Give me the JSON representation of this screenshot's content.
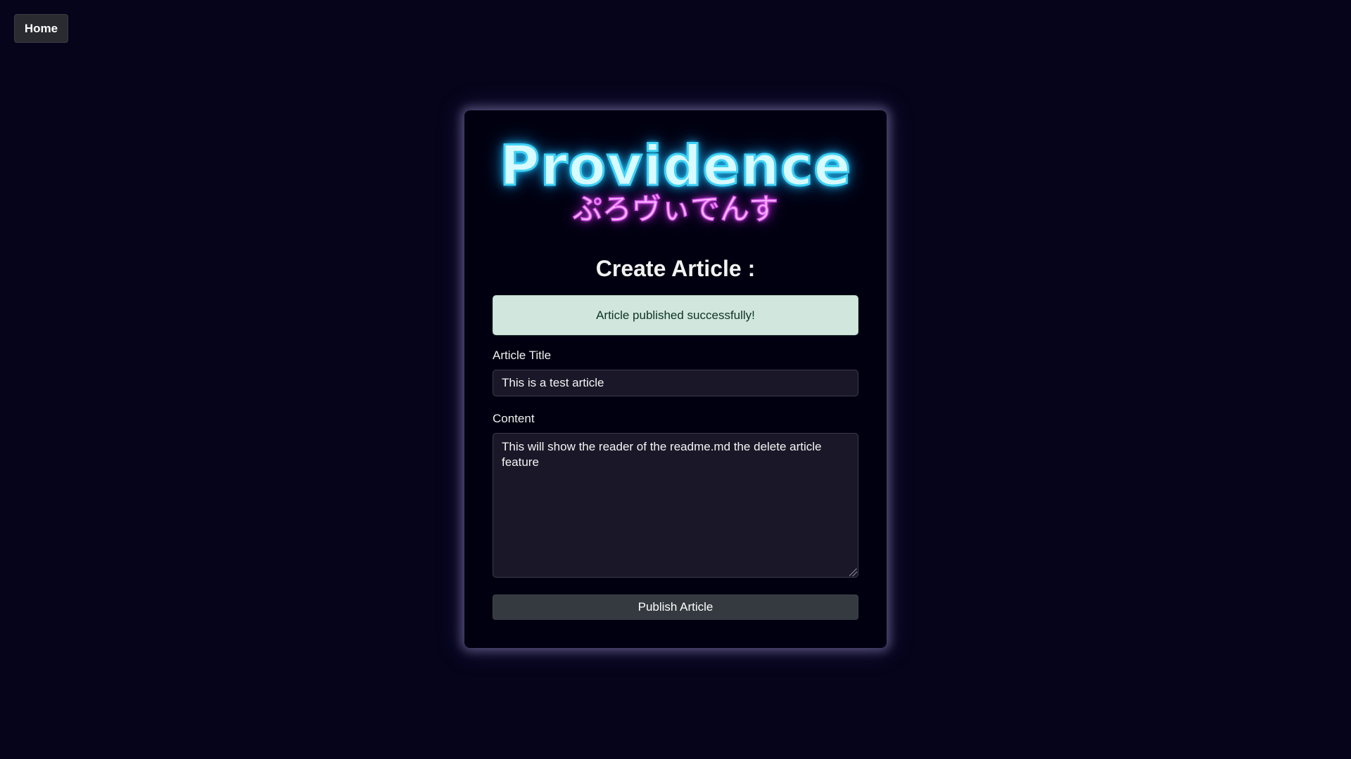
{
  "nav": {
    "home_label": "Home"
  },
  "logo": {
    "title": "Providence",
    "subtitle_jp": "ぷろヴぃでんす"
  },
  "form": {
    "heading": "Create Article :",
    "success_message": "Article published successfully!",
    "title_label": "Article Title",
    "title_value": "This is a test article",
    "content_label": "Content",
    "content_value": "This will show the reader of the readme.md the delete article feature",
    "publish_label": "Publish Article"
  },
  "colors": {
    "background": "#05041a",
    "card": "#010010",
    "success_bg": "#d1e7dd",
    "button": "#343a40",
    "logo_cyan": "#3fd2f6",
    "logo_magenta": "#e25cf5"
  }
}
